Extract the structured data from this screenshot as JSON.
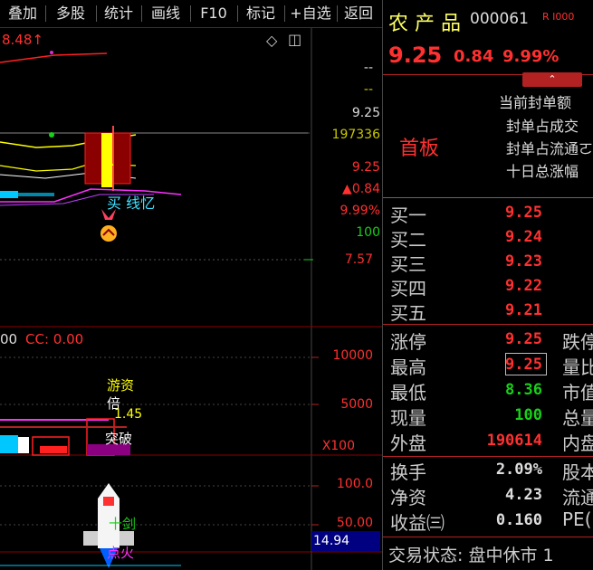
{
  "toolbar": {
    "items": [
      "叠加",
      "多股",
      "统计",
      "画线",
      "F10",
      "标记",
      "+自选",
      "返回"
    ]
  },
  "chart": {
    "top_left_price": "8.48↑",
    "price_ticks": {
      "t1": "--",
      "t2": "--",
      "t3": "9.25",
      "t4": "197336",
      "t5": "9.25",
      "t6": "▲0.84",
      "t7": "9.99%",
      "t8": "100",
      "t9": "7.57"
    },
    "mid_label_left": "00",
    "cc_label": "CC: 0.00",
    "vol_ticks": {
      "v1": "10000",
      "v2": "5000",
      "v3": "X100"
    },
    "ind_ticks": {
      "i1": "100.0",
      "i2": "50.00",
      "i3": "14.94"
    },
    "annotations": {
      "buy_sig": "买  线忆",
      "youzi": "游资",
      "bei": "倍",
      "num145": "1.45",
      "tupo": "突破",
      "shijian": "十剑",
      "dianhuo": "点火",
      "r_mark": "R"
    }
  },
  "panel": {
    "stock_name": "农 产 品",
    "stock_code": "000061",
    "tag": "R I000",
    "price": "9.25",
    "change": "0.84",
    "change_pct": "9.99%",
    "board_label": "首板",
    "seal_lines": [
      "当前封单额",
      "封单占成交",
      "封单占流通ㄛ",
      "十日总涨幅"
    ],
    "orders": [
      {
        "label": "买一",
        "price": "9.25"
      },
      {
        "label": "买二",
        "price": "9.24"
      },
      {
        "label": "买三",
        "price": "9.23"
      },
      {
        "label": "买四",
        "price": "9.22"
      },
      {
        "label": "买五",
        "price": "9.21"
      }
    ],
    "stats": [
      {
        "label": "涨停",
        "value": "9.25",
        "color": "red",
        "right": "跌停"
      },
      {
        "label": "最高",
        "value": "9.25",
        "color": "red",
        "right": "量比"
      },
      {
        "label": "最低",
        "value": "8.36",
        "color": "green",
        "right": "市值"
      },
      {
        "label": "现量",
        "value": "100",
        "color": "green",
        "right": "总量"
      },
      {
        "label": "外盘",
        "value": "190614",
        "color": "red",
        "right": "内盘"
      }
    ],
    "fund": [
      {
        "label": "换手",
        "value": "2.09%",
        "right": "股本"
      },
      {
        "label": "净资",
        "value": "4.23",
        "right": "流通"
      },
      {
        "label": "收益㈢",
        "value": "0.160",
        "right": "PE("
      }
    ],
    "trade_status": "交易状态: 盘中休市 1"
  }
}
